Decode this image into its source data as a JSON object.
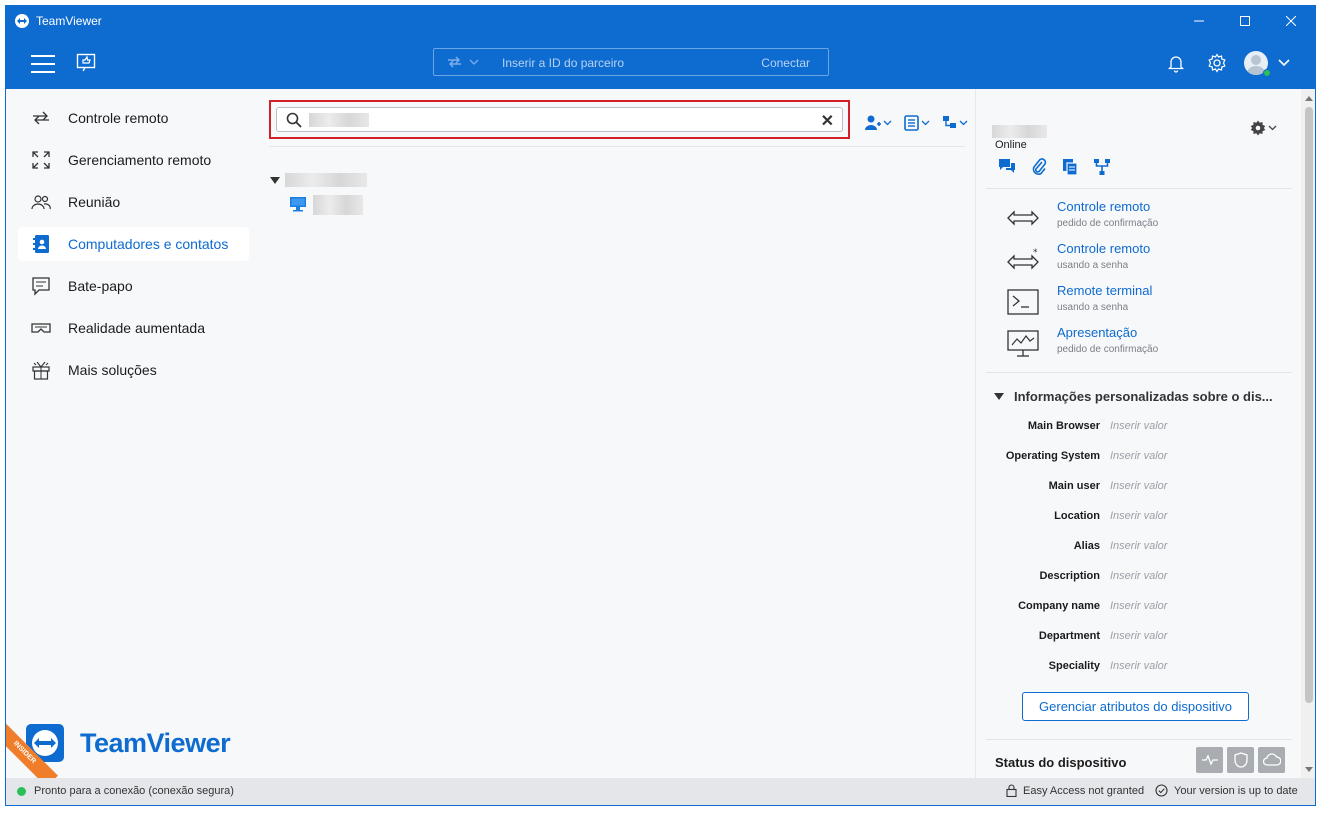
{
  "window": {
    "title": "TeamViewer"
  },
  "toolbar": {
    "partner_placeholder": "Inserir a ID do parceiro",
    "connect_label": "Conectar"
  },
  "sidebar": {
    "items": [
      {
        "label": "Controle remoto",
        "icon": "arrows-swap-icon"
      },
      {
        "label": "Gerenciamento remoto",
        "icon": "expand-icon"
      },
      {
        "label": "Reunião",
        "icon": "people-icon"
      },
      {
        "label": "Computadores e contatos",
        "icon": "contacts-book-icon",
        "active": true
      },
      {
        "label": "Bate-papo",
        "icon": "chat-icon"
      },
      {
        "label": "Realidade aumentada",
        "icon": "ar-glasses-icon"
      },
      {
        "label": "Mais soluções",
        "icon": "gift-icon"
      }
    ],
    "brand": "TeamViewer",
    "badge": "INSIDER"
  },
  "right_panel": {
    "status": "Online",
    "actions": [
      {
        "title": "Controle remoto",
        "subtitle": "pedido de confirmação"
      },
      {
        "title": "Controle remoto",
        "subtitle": "usando a senha"
      },
      {
        "title": "Remote terminal",
        "subtitle": "usando a senha"
      },
      {
        "title": "Apresentação",
        "subtitle": "pedido de confirmação"
      }
    ],
    "info_header": "Informações personalizadas sobre o dis...",
    "attributes": [
      {
        "key": "Main Browser",
        "value": "Inserir valor"
      },
      {
        "key": "Operating System",
        "value": "Inserir valor"
      },
      {
        "key": "Main user",
        "value": "Inserir valor"
      },
      {
        "key": "Location",
        "value": "Inserir valor"
      },
      {
        "key": "Alias",
        "value": "Inserir valor"
      },
      {
        "key": "Description",
        "value": "Inserir valor"
      },
      {
        "key": "Company name",
        "value": "Inserir valor"
      },
      {
        "key": "Department",
        "value": "Inserir valor"
      },
      {
        "key": "Speciality",
        "value": "Inserir valor"
      }
    ],
    "manage_button": "Gerenciar atributos do dispositivo",
    "device_status_label": "Status do dispositivo"
  },
  "statusbar": {
    "connection": "Pronto para a conexão (conexão segura)",
    "easy_access": "Easy Access not granted",
    "version": "Your version is up to date"
  },
  "colors": {
    "accent": "#0e6bd0",
    "highlight": "#d31f26",
    "online": "#2bbf5a",
    "insider": "#f07d2a"
  }
}
